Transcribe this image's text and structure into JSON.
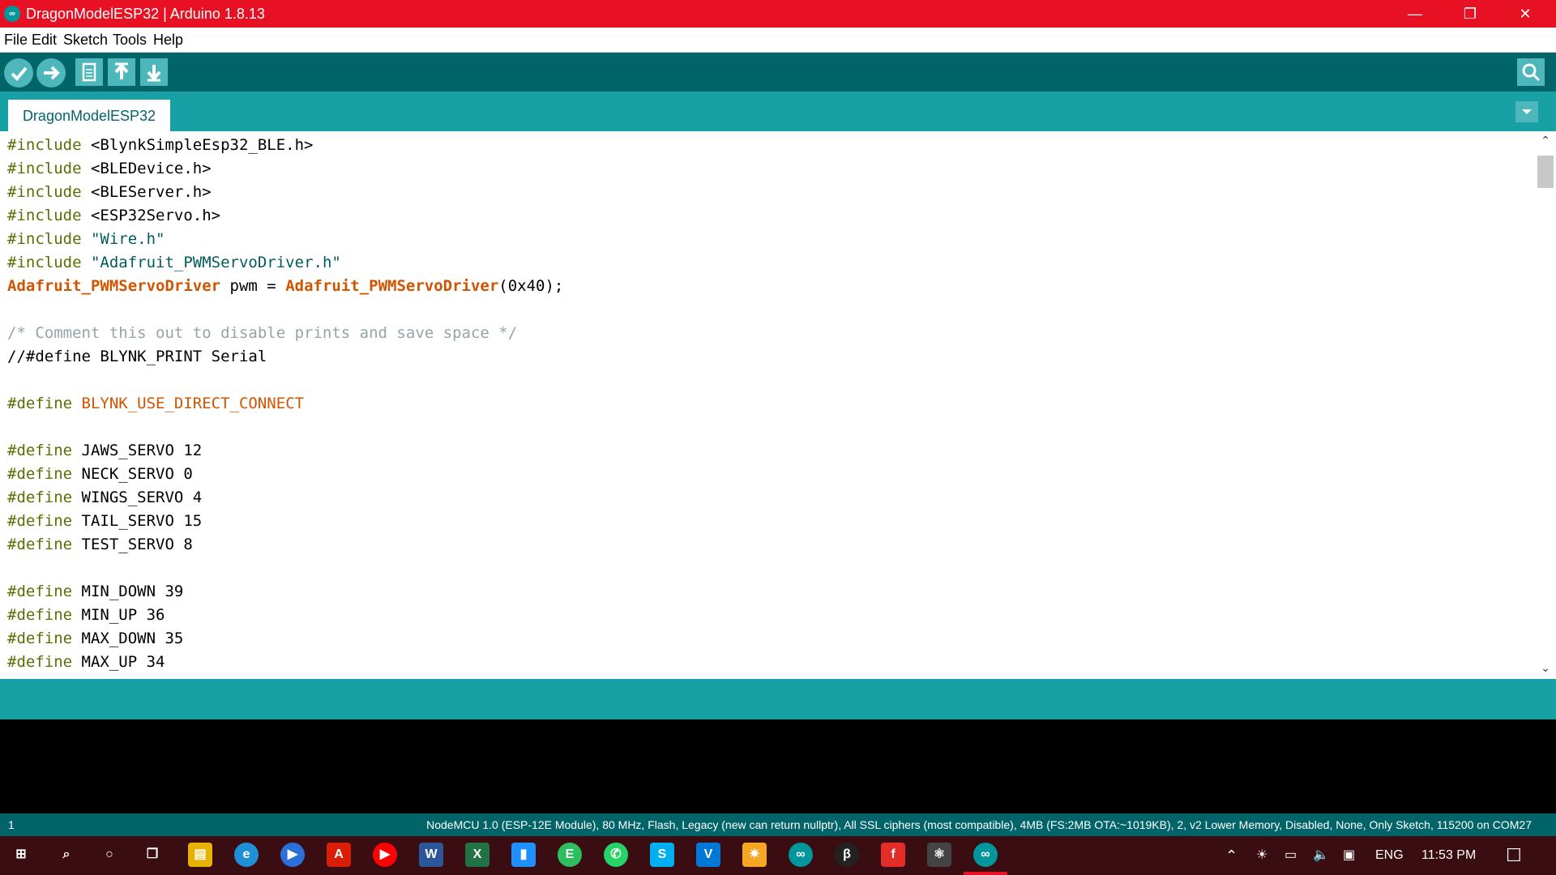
{
  "window": {
    "title": "DragonModelESP32 | Arduino 1.8.13",
    "app_icon": "∞",
    "colors": {
      "titlebar": "#e81123",
      "toolbar": "#006468",
      "tabbar": "#17a1a5"
    }
  },
  "window_controls": {
    "minimize_icon": "minimize-icon",
    "restore_icon": "restore-icon",
    "close_icon": "close-icon"
  },
  "menu": [
    {
      "label": "File"
    },
    {
      "label": "Edit"
    },
    {
      "label": "Sketch"
    },
    {
      "label": "Tools"
    },
    {
      "label": "Help"
    }
  ],
  "toolbar": {
    "buttons": [
      {
        "name": "verify",
        "icon": "check-icon"
      },
      {
        "name": "upload",
        "icon": "arrow-right-icon"
      },
      {
        "name": "new",
        "icon": "new-file-icon"
      },
      {
        "name": "open",
        "icon": "arrow-up-icon"
      },
      {
        "name": "save",
        "icon": "arrow-down-icon"
      }
    ],
    "serial_monitor_icon": "magnifier-icon"
  },
  "tabs": [
    {
      "label": "DragonModelESP32",
      "active": true
    }
  ],
  "tab_menu_icon": "chevron-down-icon",
  "editor": {
    "lines": [
      {
        "a": "#include",
        "b": " <BlynkSimpleEsp32_BLE.h>"
      },
      {
        "a": "#include",
        "b": " <BLEDevice.h>"
      },
      {
        "a": "#include",
        "b": " <BLEServer.h>"
      },
      {
        "a": "#include",
        "b": " <ESP32Servo.h>"
      },
      {
        "a": "#include",
        "b": " ",
        "c": "\"Wire.h\""
      },
      {
        "a": "#include",
        "b": " ",
        "c": "\"Adafruit_PWMServoDriver.h\""
      },
      {
        "t1": "Adafruit_PWMServoDriver",
        "m": " pwm = ",
        "t2": "Adafruit_PWMServoDriver",
        "e": "(0x40);"
      },
      {},
      {
        "comment": "/* Comment this out to disable prints and save space */"
      },
      {
        "plain": "//#define BLYNK_PRINT Serial"
      },
      {},
      {
        "a": "#define",
        "b": " ",
        "k": "BLYNK_USE_DIRECT_CONNECT"
      },
      {},
      {
        "a": "#define",
        "b": " JAWS_SERVO 12"
      },
      {
        "a": "#define",
        "b": " NECK_SERVO 0"
      },
      {
        "a": "#define",
        "b": " WINGS_SERVO 4"
      },
      {
        "a": "#define",
        "b": " TAIL_SERVO 15"
      },
      {
        "a": "#define",
        "b": " TEST_SERVO 8"
      },
      {},
      {
        "a": "#define",
        "b": " MIN_DOWN 39"
      },
      {
        "a": "#define",
        "b": " MIN_UP 36"
      },
      {
        "a": "#define",
        "b": " MAX_DOWN 35"
      },
      {
        "a": "#define",
        "b": " MAX_UP 34"
      }
    ]
  },
  "status": {
    "line_number": "1",
    "board": "NodeMCU 1.0 (ESP-12E Module), 80 MHz, Flash, Legacy (new can return nullptr), All SSL ciphers (most compatible), 4MB (FS:2MB OTA:~1019KB), 2, v2 Lower Memory, Disabled, None, Only Sketch, 115200 on COM27"
  },
  "taskbar": {
    "apps": [
      {
        "name": "start",
        "glyph": "⊞",
        "color": "#3a0d12"
      },
      {
        "name": "search",
        "glyph": "⌕",
        "color": "#3a0d12"
      },
      {
        "name": "cortana",
        "glyph": "○",
        "color": "#3a0d12"
      },
      {
        "name": "task-view",
        "glyph": "❐",
        "color": "#3a0d12"
      },
      {
        "name": "file-explorer",
        "glyph": "▤",
        "color": "#e8b200"
      },
      {
        "name": "edge",
        "glyph": "e",
        "color": "#1f8fd6"
      },
      {
        "name": "media-player",
        "glyph": "▶",
        "color": "#2d6fd8"
      },
      {
        "name": "acrobat",
        "glyph": "A",
        "color": "#d81e06"
      },
      {
        "name": "youtube",
        "glyph": "▶",
        "color": "#ff0000"
      },
      {
        "name": "word",
        "glyph": "W",
        "color": "#2b579a"
      },
      {
        "name": "excel",
        "glyph": "X",
        "color": "#217346"
      },
      {
        "name": "notepad",
        "glyph": "▮",
        "color": "#1e90ff"
      },
      {
        "name": "evernote",
        "glyph": "E",
        "color": "#2dbe60"
      },
      {
        "name": "whatsapp",
        "glyph": "✆",
        "color": "#25d366"
      },
      {
        "name": "skype",
        "glyph": "S",
        "color": "#00aff0"
      },
      {
        "name": "vs-code",
        "glyph": "V",
        "color": "#0078d7"
      },
      {
        "name": "figma-like",
        "glyph": "✷",
        "color": "#f5a623"
      },
      {
        "name": "arduino-2",
        "glyph": "∞",
        "color": "#00979c"
      },
      {
        "name": "bracket-app",
        "glyph": "β",
        "color": "#222222"
      },
      {
        "name": "flash",
        "glyph": "f",
        "color": "#e52d27"
      },
      {
        "name": "electron-app",
        "glyph": "⚛",
        "color": "#444444"
      },
      {
        "name": "arduino-active",
        "glyph": "∞",
        "color": "#00979c"
      }
    ],
    "tray": {
      "language": "ENG",
      "time": "11:53 PM",
      "notification_icon": "notification-icon"
    }
  }
}
